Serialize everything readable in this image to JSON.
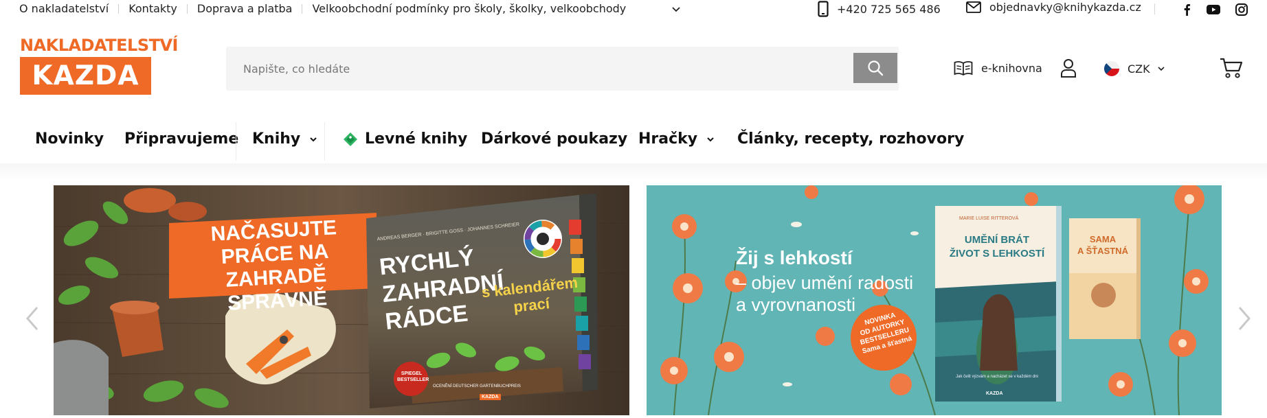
{
  "top_links": [
    "O nakladatelství",
    "Kontakty",
    "Doprava a platba",
    "Velkoobchodní podmínky pro školy, školky, velkoobchody"
  ],
  "phone": "+420 725 565 486",
  "email": "objednavky@knihykazda.cz",
  "social": [
    "facebook-icon",
    "youtube-icon",
    "instagram-icon"
  ],
  "logo": {
    "line1": "NAKLADATELSTVÍ",
    "line2": "KAZDA"
  },
  "search": {
    "placeholder": "Napište, co hledáte"
  },
  "header": {
    "ebook_label": "e-knihovna",
    "currency": "CZK"
  },
  "nav": {
    "novinky": "Novinky",
    "pripravujeme": "Připravujeme",
    "knihy": "Knihy",
    "levne": "Levné knihy",
    "poukazy": "Dárkové poukazy",
    "hracky": "Hračky",
    "clanky": "Články, recepty, rozhovory"
  },
  "banner1": {
    "headline": [
      "NAČASUJTE",
      "PRÁCE NA ZAHRADĚ",
      "SPRÁVNĚ"
    ],
    "authors": "ANDREAS BERGER · BRIGITTE GOSS · JOHANNES SCHREIER",
    "book_title": [
      "RYCHLÝ",
      "ZAHRADNÍ",
      "RÁDCE"
    ],
    "book_subtitle": [
      "s kalendářem",
      "prací"
    ],
    "badge": [
      "SPIEGEL",
      "BESTSELLER"
    ],
    "award": "OCENĚNÍ DEUTSCHER GARTENBUCHPREIS",
    "publisher": "KAZDA"
  },
  "banner2": {
    "title": "Žij s lehkostí",
    "subtitle": [
      "– objev umění radosti",
      "a vyrovnanosti"
    ],
    "badge": [
      "NOVINKA",
      "OD AUTORKY",
      "BESTSELLERU",
      "Sama a šťastná"
    ],
    "book1_author": "MARIE LUISE RITTEROVÁ",
    "book1_title": [
      "UMĚNÍ BRÁT",
      "ŽIVOT S LEHKOSTÍ"
    ],
    "book1_tagline": "Jak čelit výzvám a nacházet se v každém dni",
    "book2_title": [
      "SAMA",
      "A ŠŤASTNÁ"
    ],
    "publisher": "KAZDA"
  },
  "colors": {
    "brand": "#ef6a26",
    "search_button": "#8c8c8c",
    "banner2_bg": "#61b5b5"
  }
}
